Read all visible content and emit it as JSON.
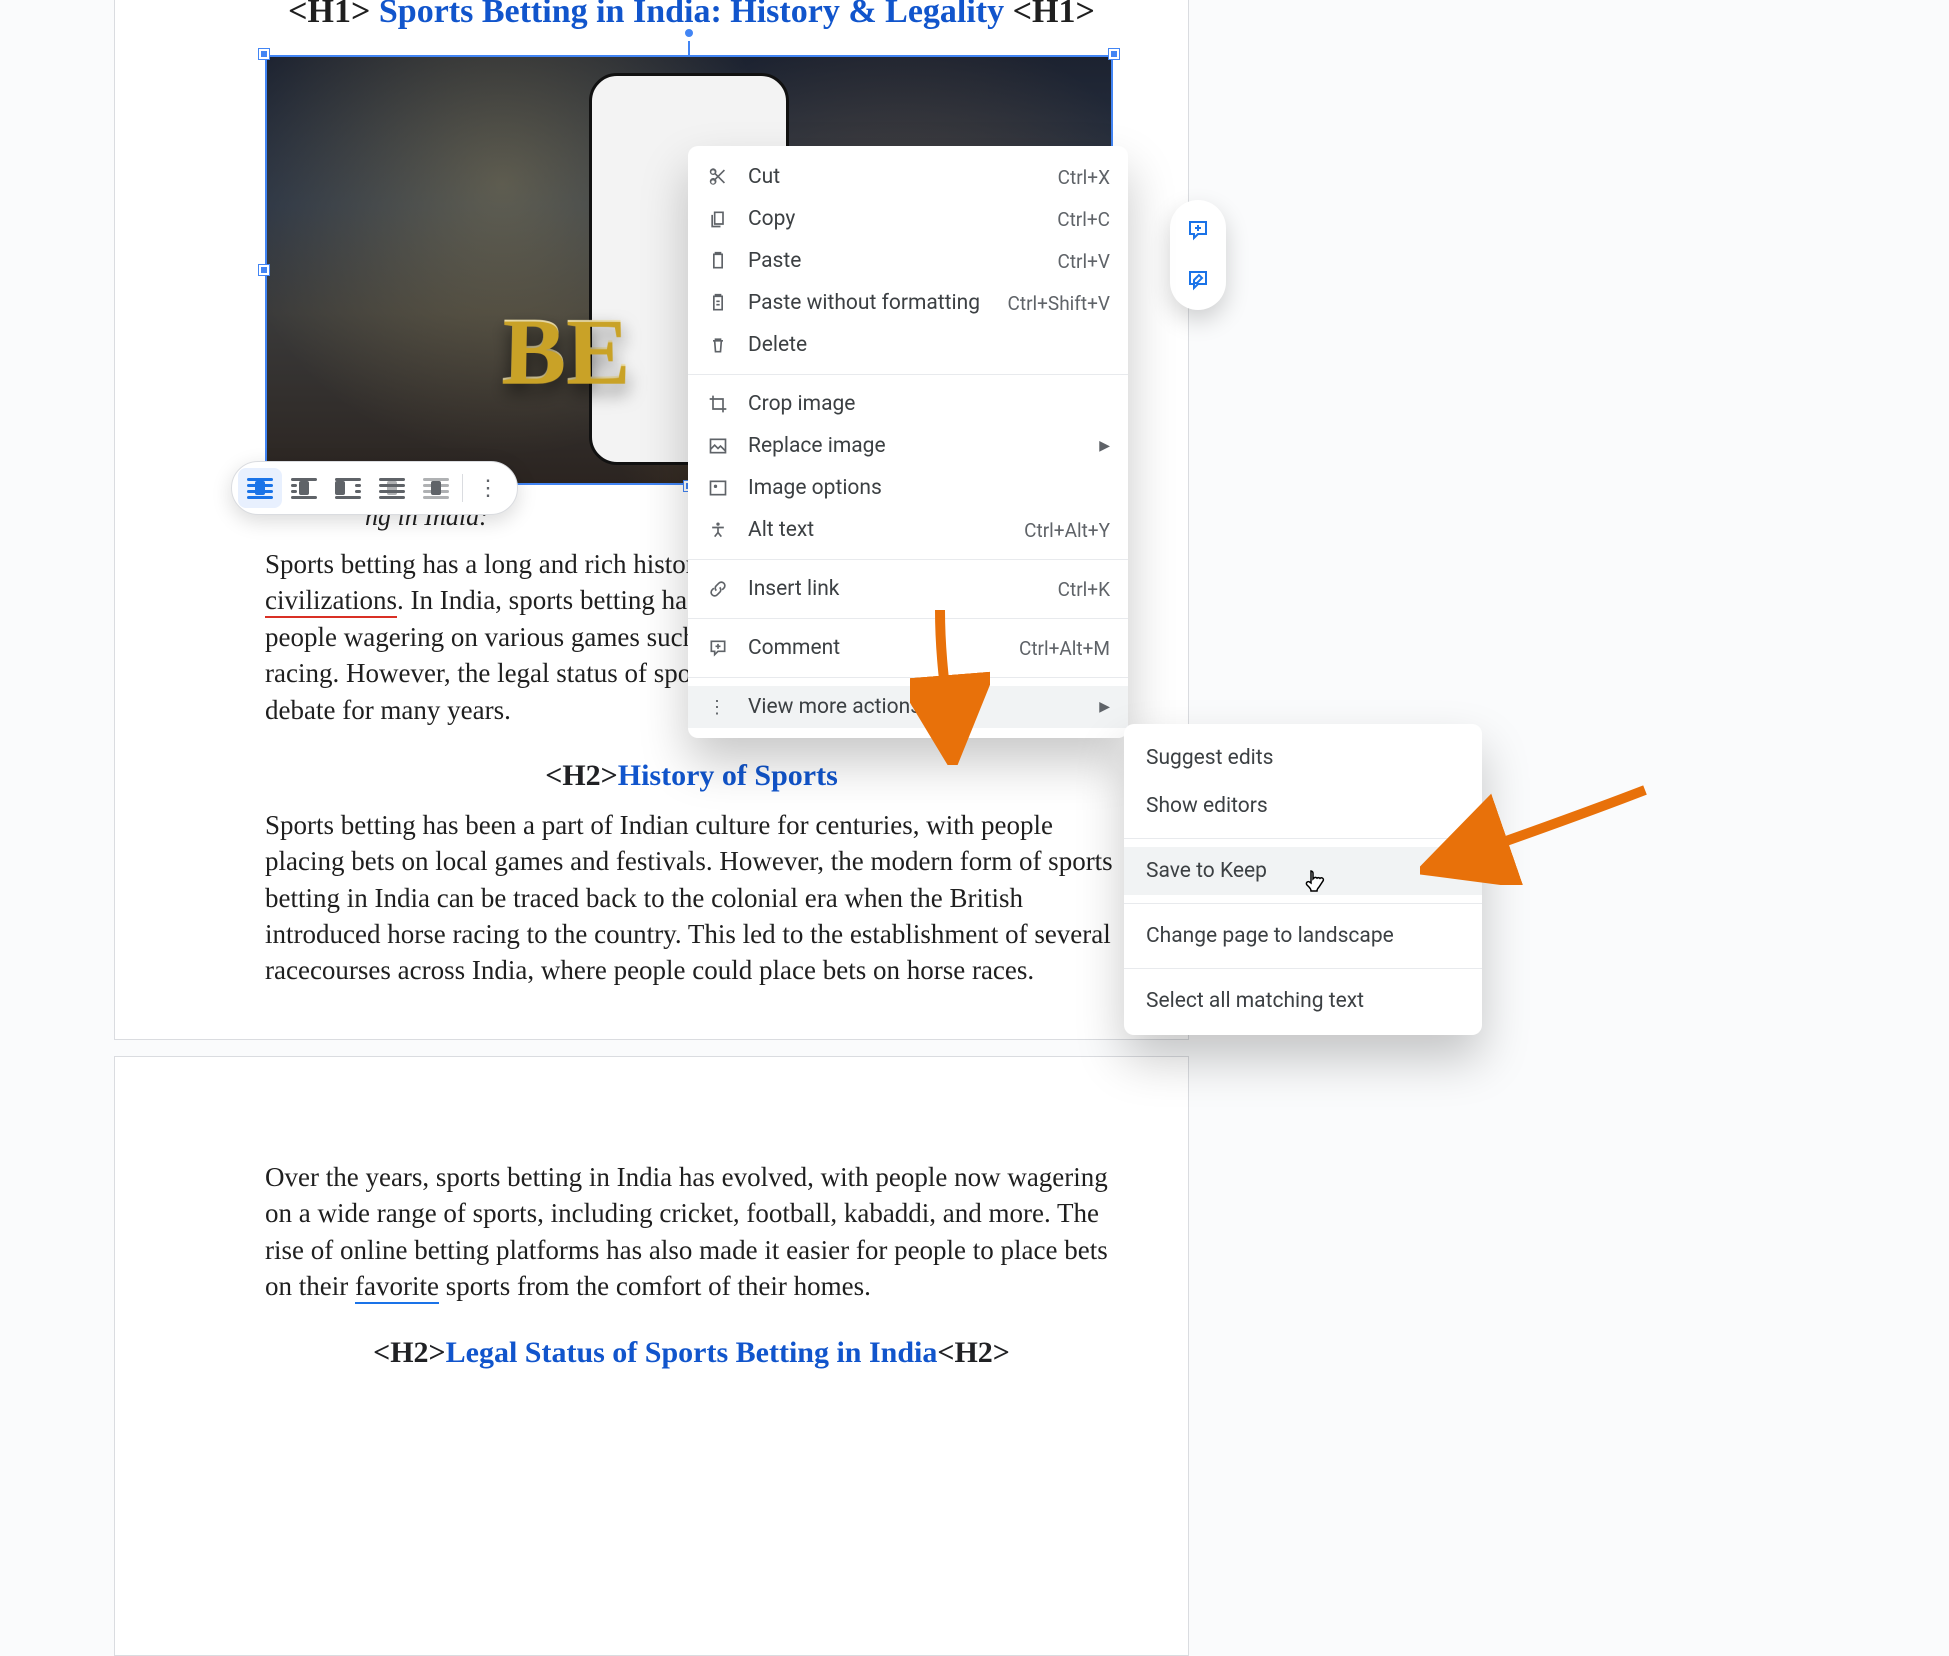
{
  "doc": {
    "h1_prefix": "<H1>",
    "h1_link": "Sports Betting in India: History & Legality",
    "h1_suffix": "<H1>",
    "image_alt": "Sports betting illustration with phone and gold BET text",
    "bet_text": "BE",
    "caption_visible": "ng in India:",
    "para1_a": "Sports betting has a long and rich history,",
    "para1_civ": "civilizations",
    "para1_b": ". In India, sports betting has b",
    "para1_c": "people wagering on various games such a",
    "para1_d": "racing. However, the legal status of sports",
    "para1_e": "debate for many years.",
    "h2a_tag_open": "<H2>",
    "h2a_link": "History of Sports",
    "para2": "Sports betting has been a part of Indian culture for centuries, with people placing bets on local games and festivals. However, the modern form of sports betting in India can be traced back to the colonial era when the British introduced horse racing to the country. This led to the establishment of several racecourses across India, where people could place bets on horse races.",
    "para3_a": "Over the years, sports betting in India has evolved, with people now wagering on a wide range of sports, including cricket, football, kabaddi, and more. The rise of online betting platforms has also made it easier for people to place bets on their ",
    "para3_fav": "favorite",
    "para3_b": " sports from the comfort of their homes.",
    "h2b_tag_open": "<H2>",
    "h2b_link": "Legal Status of Sports Betting in India",
    "h2b_tag_close": "<H2>"
  },
  "menu": {
    "cut": {
      "label": "Cut",
      "shortcut": "Ctrl+X"
    },
    "copy": {
      "label": "Copy",
      "shortcut": "Ctrl+C"
    },
    "paste": {
      "label": "Paste",
      "shortcut": "Ctrl+V"
    },
    "paste_nf": {
      "label": "Paste without formatting",
      "shortcut": "Ctrl+Shift+V"
    },
    "delete": {
      "label": "Delete"
    },
    "crop": {
      "label": "Crop image"
    },
    "replace": {
      "label": "Replace image"
    },
    "options": {
      "label": "Image options"
    },
    "alt": {
      "label": "Alt text",
      "shortcut": "Ctrl+Alt+Y"
    },
    "link": {
      "label": "Insert link",
      "shortcut": "Ctrl+K"
    },
    "comment": {
      "label": "Comment",
      "shortcut": "Ctrl+Alt+M"
    },
    "more": {
      "label": "View more actions"
    }
  },
  "submenu": {
    "suggest": {
      "label": "Suggest edits"
    },
    "editors": {
      "label": "Show editors"
    },
    "keep": {
      "label": "Save to Keep"
    },
    "landscape": {
      "label": "Change page to landscape"
    },
    "matchsel": {
      "label": "Select all matching text"
    }
  },
  "fab": {
    "add_comment": "Add comment",
    "suggest_edit": "Suggest edits"
  },
  "image_toolbar": {
    "options": [
      "In line",
      "Wrap text",
      "Break text",
      "Behind text",
      "In front of text"
    ],
    "active_index": 0,
    "more": "More image options"
  }
}
